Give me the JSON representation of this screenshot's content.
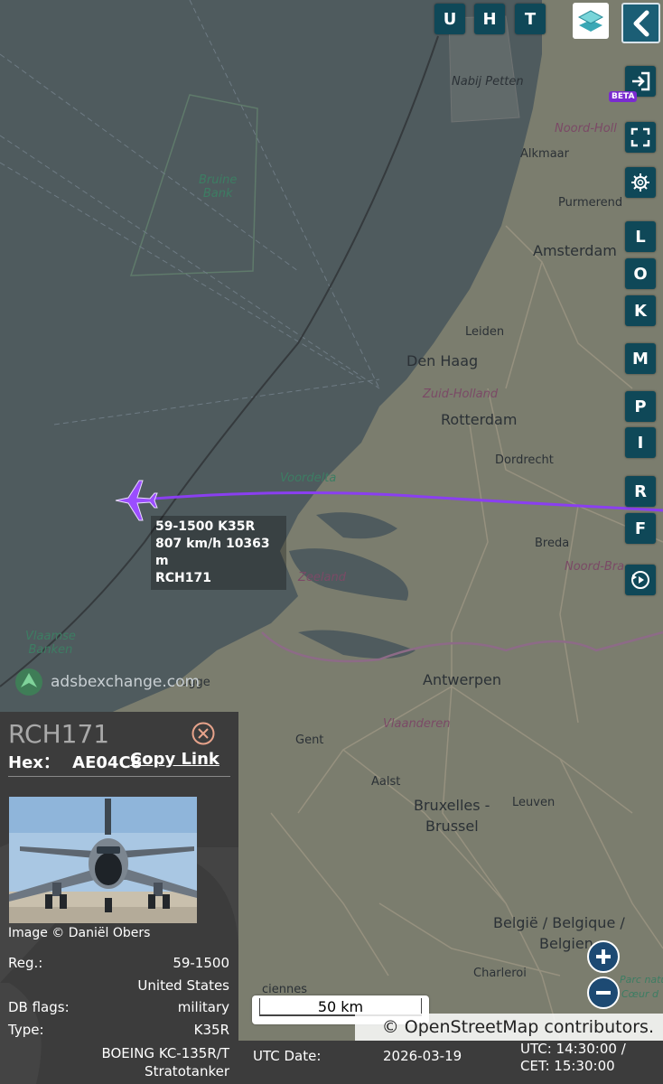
{
  "toolbar_top": {
    "u": "U",
    "h": "H",
    "t": "T"
  },
  "sidebar_right": {
    "beta": "BETA",
    "letters": [
      "L",
      "O",
      "K",
      "M",
      "P",
      "I",
      "R",
      "F"
    ]
  },
  "map": {
    "labels": {
      "nabij_petten": "Nabij Petten",
      "noord_holland": "Noord-Holl",
      "alkmaar": "Alkmaar",
      "purmerend": "Purmerend",
      "amsterdam": "Amsterdam",
      "bruine_bank": "Bruine\nBank",
      "leiden": "Leiden",
      "den_haag": "Den Haag",
      "zuid_holland": "Zuid-Holland",
      "rotterdam": "Rotterdam",
      "dordrecht": "Dordrecht",
      "voordelta": "Voordelta",
      "breda": "Breda",
      "noord_bra": "Noord-Bra",
      "zeeland": "Zeeland",
      "vlaamse_banken": "Vlaamse\nBanken",
      "antwerpen": "Antwerpen",
      "vlaanderen": "Vlaanderen",
      "gent": "Gent",
      "aalst": "Aalst",
      "bruxelles": "Bruxelles -",
      "brussel": "Brussel",
      "leuven": "Leuven",
      "belgie": "België / Belgique /",
      "belgie2": "Belgien",
      "charleroi": "Charleroi",
      "parc": "Parc natu",
      "coeur": "Cœur d",
      "ostende": "Ostende",
      "brugge": "ugge",
      "ciennes": "ciennes"
    },
    "aircraft_label": {
      "line1": "59-1500 K35R",
      "line2": "807 km/h  10363 m",
      "line3": "RCH171"
    },
    "watermark": "adsbexchange.com",
    "scale": "50 km",
    "attribution": "© OpenStreetMap contributors.",
    "colors": {
      "track": "#8a3ff0",
      "aircraft": "#9b4dff",
      "sea": "#4f5b5e"
    }
  },
  "panel": {
    "callsign": "RCH171",
    "hex_label": "Hex：",
    "hex_value": "AE04C8",
    "copy_link": "Copy Link",
    "image_credit": "Image © Daniël Obers",
    "rows": [
      {
        "label": "Reg.:",
        "value": "59-1500"
      },
      {
        "label": "",
        "value": "United States"
      },
      {
        "label": "DB flags:",
        "value": "military"
      },
      {
        "label": "Type:",
        "value": "K35R"
      },
      {
        "label": "",
        "value": "BOEING KC-135R/T"
      },
      {
        "label": "",
        "value": "Stratotanker"
      }
    ]
  },
  "status": {
    "utc_date_label": "UTC Date:",
    "utc_date_value": "2026-03-19",
    "utc_time": "UTC: 14:30:00 /",
    "cet_time": "CET: 15:30:00"
  }
}
